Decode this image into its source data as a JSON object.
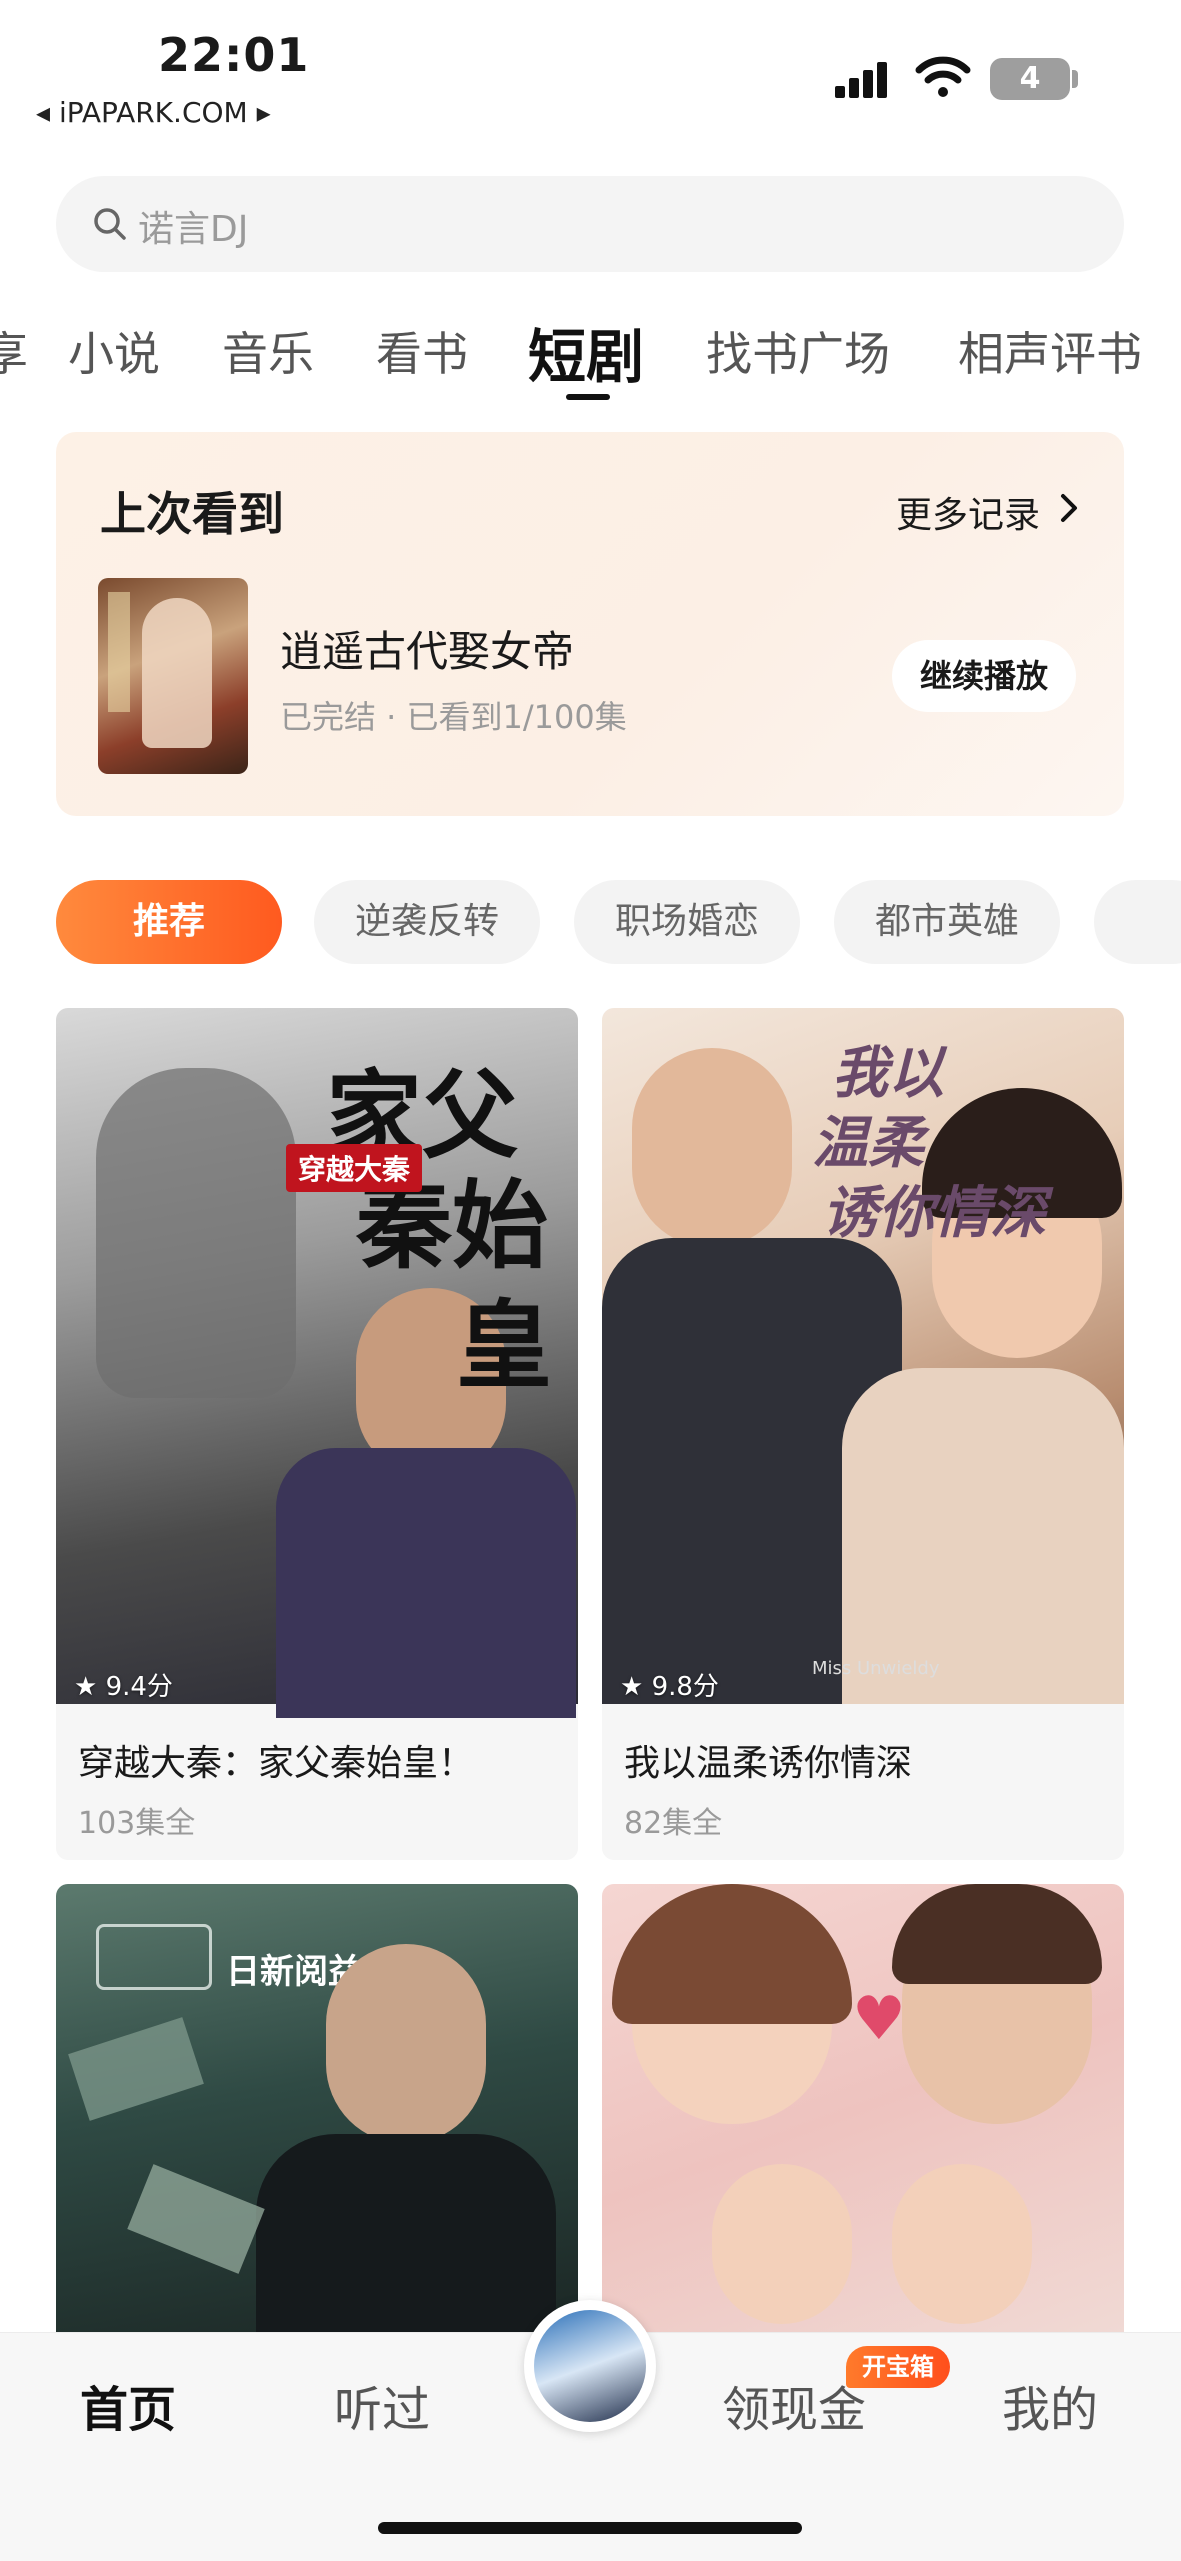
{
  "status_bar": {
    "time": "22:01",
    "carrier": "◂ iPAPARK.COM ▸",
    "battery": "4"
  },
  "search": {
    "placeholder": "诺言DJ"
  },
  "top_tabs": [
    "享",
    "小说",
    "音乐",
    "看书",
    "短剧",
    "找书广场",
    "相声评书"
  ],
  "active_tab": "短剧",
  "history": {
    "title": "上次看到",
    "more_label": "更多记录",
    "drama_title": "逍遥古代娶女帝",
    "progress": "已完结 · 已看到1/100集",
    "continue_label": "继续播放"
  },
  "chips": [
    "推荐",
    "逆袭反转",
    "职场婚恋",
    "都市英雄"
  ],
  "dramas": [
    {
      "title": "穿越大秦：家父秦始皇！",
      "episodes": "103集全",
      "rating": "9.4分",
      "poster_text": "家父秦始皇",
      "poster_tag": "穿越大秦"
    },
    {
      "title": "我以温柔诱你情深",
      "episodes": "82集全",
      "rating": "9.8分",
      "poster_text": "我以温柔诱你情深",
      "poster_sub": "Miss Unwieldy"
    },
    {
      "title": "",
      "episodes": "",
      "rating": "",
      "poster_text": "日新阅益"
    },
    {
      "title": "",
      "episodes": "",
      "rating": ""
    }
  ],
  "bottom_nav": {
    "home": "首页",
    "listened": "听过",
    "cash": "领现金",
    "mine": "我的",
    "badge": "开宝箱"
  },
  "colors": {
    "accent": "#ff5a1f",
    "text": "#1a1a1a",
    "muted": "#9a9a9a"
  }
}
